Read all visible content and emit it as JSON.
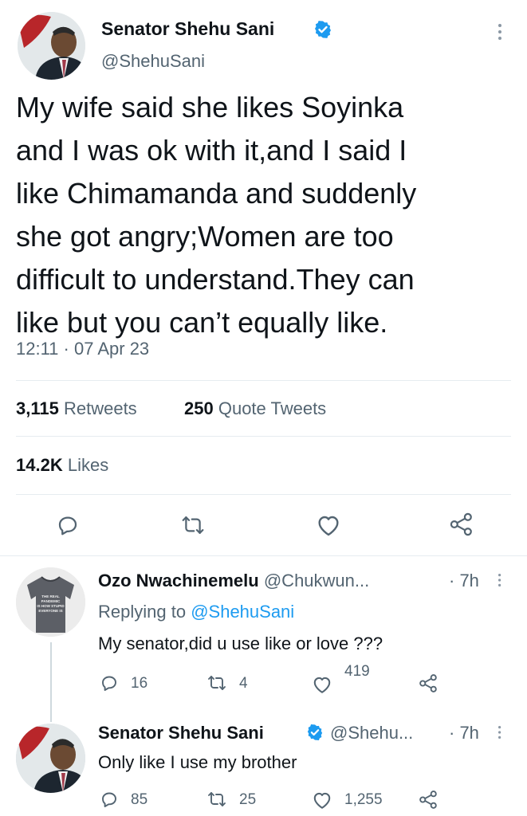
{
  "main_tweet": {
    "author_name": "Senator Shehu Sani",
    "handle": "@ShehuSani",
    "text_lines": [
      "My wife said she likes Soyinka",
      "and I was ok with it,and I said I",
      "like Chimamanda and  suddenly",
      "she got angry;Women are too",
      "difficult to understand.They can",
      "like but you can’t equally like."
    ],
    "timestamp": "12:11 · 07 Apr 23",
    "retweets_count": "3,115",
    "retweets_label": "Retweets",
    "quotes_count": "250",
    "quotes_label": "Quote Tweets",
    "likes_count": "14.2K",
    "likes_label": "Likes"
  },
  "replies": [
    {
      "author_name": "Ozo Nwachinemelu",
      "handle": "@Chukwun...",
      "time": "· 7h",
      "replying_prefix": "Replying to",
      "replying_to": "@ShehuSani",
      "text": "My senator,did u use like or love ???",
      "reply_count": "16",
      "retweet_count": "4",
      "like_count": "419",
      "avatar_shirt_text": "THE REAL PANDEMIC IS HOW STUPID EVERYONE IS"
    },
    {
      "author_name": "Senator Shehu Sani",
      "handle": "@Shehu...",
      "time": "· 7h",
      "text": "Only like I use my brother",
      "reply_count": "85",
      "retweet_count": "25",
      "like_count": "1,255"
    }
  ],
  "colors": {
    "verified": "#1d9bf0",
    "text": "#0f1419",
    "muted": "#536471",
    "link": "#1d9bf0"
  }
}
